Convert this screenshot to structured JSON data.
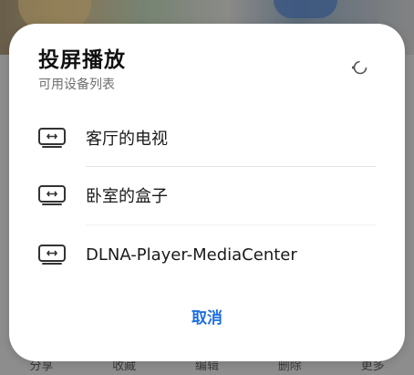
{
  "background": {
    "bottom_bar": [
      "分享",
      "收藏",
      "编辑",
      "删除",
      "更多"
    ]
  },
  "dialog": {
    "title": "投屏播放",
    "subtitle": "可用设备列表",
    "refresh_icon": "loading-spinner-icon",
    "devices": [
      {
        "label": "客厅的电视",
        "icon": "cast-device-icon"
      },
      {
        "label": "卧室的盒子",
        "icon": "cast-device-icon"
      },
      {
        "label": "DLNA-Player-MediaCenter",
        "icon": "cast-device-icon"
      }
    ],
    "cancel_label": "取消",
    "accent_color": "#1f6fe0"
  }
}
